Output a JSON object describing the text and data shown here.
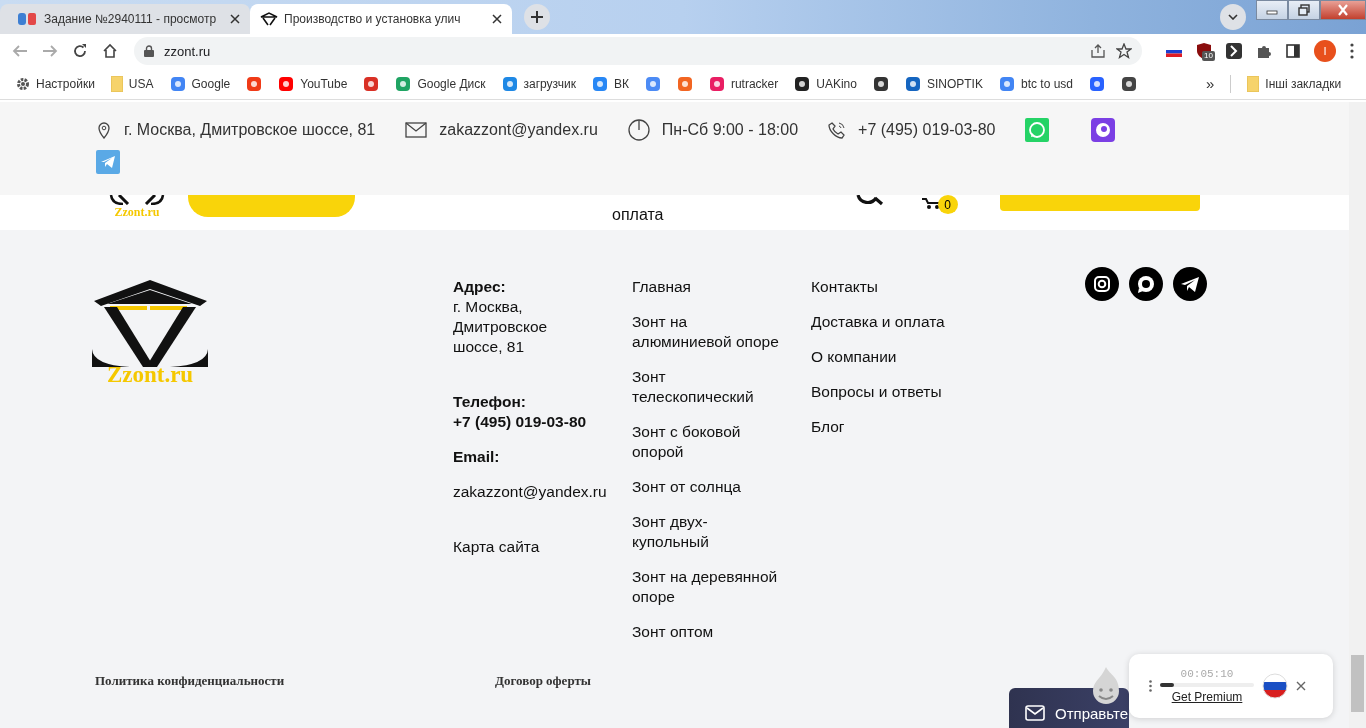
{
  "browser": {
    "tabs": [
      {
        "title": "Задание №2940111 - просмотр",
        "selected": false
      },
      {
        "title": "Производство и установка улич",
        "selected": true
      }
    ],
    "address": "zzont.ru",
    "extension_badge": "10",
    "profile": "I",
    "more_bookmarks": "»",
    "bookmarks": [
      {
        "kind": "link",
        "label": "Настройки"
      },
      {
        "kind": "link",
        "label": "USA"
      },
      {
        "kind": "link",
        "label": "Google"
      },
      {
        "kind": "icon"
      },
      {
        "kind": "link",
        "label": "YouTube"
      },
      {
        "kind": "icon"
      },
      {
        "kind": "link",
        "label": "Google Диск"
      },
      {
        "kind": "link",
        "label": "загрузчик"
      },
      {
        "kind": "link",
        "label": "ВК"
      },
      {
        "kind": "icon"
      },
      {
        "kind": "icon"
      },
      {
        "kind": "link",
        "label": "rutracker"
      },
      {
        "kind": "link",
        "label": "UAKino"
      },
      {
        "kind": "icon"
      },
      {
        "kind": "link",
        "label": "SINOPTIK"
      },
      {
        "kind": "link",
        "label": "btc to usd"
      },
      {
        "kind": "icon"
      },
      {
        "kind": "icon"
      }
    ],
    "other_bookmarks": "Інші закладки"
  },
  "topbar": {
    "address": "г. Москва, Дмитровское шоссе, 81",
    "email": "zakazzont@yandex.ru",
    "hours": "Пн-Сб 9:00 - 18:00",
    "phone": "+7 (495) 019-03-80"
  },
  "header": {
    "logo_text": "Zzont.ru",
    "nav": [
      "оплата"
    ],
    "cart_count": "0"
  },
  "footer": {
    "logo_text": "Zzont.ru",
    "contacts": [
      {
        "label": "Адрес:",
        "value": "г. Москва, Дмитровское шоссе, 81"
      },
      {
        "label": "Телефон:",
        "value": "+7 (495) 019-03-80"
      },
      {
        "label": "Email:",
        "value": "zakazzont@yandex.ru"
      }
    ],
    "sitemap": "Карта сайта",
    "menu_1": [
      "Главная",
      "Зонт на алюминиевой опоре",
      "Зонт телескопический",
      "Зонт с боковой опорой",
      "Зонт от солнца",
      "Зонт двух-купольный",
      "Зонт на деревянной опоре",
      "Зонт оптом"
    ],
    "menu_2": [
      "Контакты",
      "Доставка и оплата",
      "О компании",
      "Вопросы и ответы",
      "Блог"
    ],
    "bottom_links": [
      "Политика конфиденциальности",
      "Договор оферты"
    ]
  },
  "chat_button": "Отправьте",
  "vpn": {
    "timer": "00:05:10",
    "level": 0.15,
    "link": "Get Premium"
  }
}
